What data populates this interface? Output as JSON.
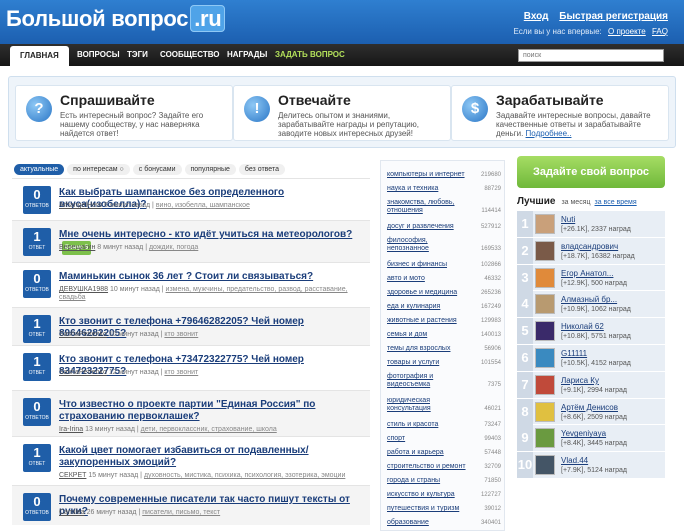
{
  "header": {
    "logo_text": "Большой вопрос",
    "logo_tld": ".ru",
    "login": "Вход",
    "register": "Быстрая регистрация",
    "first_time_text": "Если вы у нас впервые:",
    "about_link": "О проекте",
    "faq_link": "FAQ"
  },
  "nav": {
    "items": [
      "ГЛАВНАЯ",
      "ВОПРОСЫ",
      "ТЭГИ",
      "СООБЩЕСТВО",
      "НАГРАДЫ",
      "ЗАДАТЬ ВОПРОС"
    ],
    "search_placeholder": "поиск"
  },
  "promo": [
    {
      "icon": "question-icon",
      "glyph": "?",
      "title": "Спрашивайте",
      "text": "Есть интересный вопрос? Задайте его нашему сообществу, у нас наверняка найдется ответ!",
      "link": ""
    },
    {
      "icon": "exclamation-icon",
      "glyph": "!",
      "title": "Отвечайте",
      "text": "Делитесь опытом и знаниями, зарабатывайте награды и репутацию, заводите новых интересных друзей!",
      "link": ""
    },
    {
      "icon": "dollar-icon",
      "glyph": "$",
      "title": "Зарабатывайте",
      "text": "Задавайте интересные вопросы, давайте качественные ответы и зарабатывайте деньги.",
      "link": "Подробнее.."
    }
  ],
  "filter_tabs": [
    "актуальные",
    "по интересам ○",
    "с бонусами",
    "популярные",
    "без ответа"
  ],
  "questions": [
    {
      "count": "0",
      "count_label": "ОТВЕТОВ",
      "title": "Как выбрать шампанское без определенного вкуса(изобелла)?",
      "bonus": "",
      "user": "ArhangelHero",
      "time": "6 минут назад",
      "tags": "вино, изобелла, шампанское"
    },
    {
      "count": "1",
      "count_label": "ОТВЕТ",
      "title": "Мне очень интересно - кто идёт учиться на метеорологов?",
      "bonus": "Бонус 5",
      "user": "Верещагин",
      "time": "8 минут назад",
      "tags": "дождик, погода"
    },
    {
      "count": "0",
      "count_label": "ОТВЕТОВ",
      "title": "Маминькин сынок 36 лет ? Стоит ли связываться?",
      "bonus": "",
      "user": "ДЕВУШКА1988",
      "time": "10 минут назад",
      "tags": "измена, мужчины, предательство, развод, расставание, свадьба"
    },
    {
      "count": "1",
      "count_label": "ОТВЕТ",
      "title": "Кто звонит с телефона +79646282205? Чей номер 89646282205?",
      "bonus": "",
      "user": "SashaPetrenko",
      "time": "10 минут назад",
      "tags": "кто звонит"
    },
    {
      "count": "1",
      "count_label": "ОТВЕТ",
      "title": "Кто звонит с телефона +73472322775? Чей номер 83472322775?",
      "bonus": "",
      "user": "SashaPetrenko",
      "time": "12 минут назад",
      "tags": "кто звонит"
    },
    {
      "count": "0",
      "count_label": "ОТВЕТОВ",
      "title": "Что известно о проекте партии \"Единая Россия\" по страхованию первоклашек?",
      "bonus": "",
      "user": "Ira-Irina",
      "time": "13 минут назад",
      "tags": "дети, первоклассник, страхование, школа"
    },
    {
      "count": "1",
      "count_label": "ОТВЕТ",
      "title": "Какой цвет помогает избавиться от подавленных/закупоренных эмоций?",
      "bonus": "",
      "user": "СЕКРЕТ",
      "time": "15 минут назад",
      "tags": "духовность, мистика, психика, психология, эзотерика, эмоции"
    },
    {
      "count": "0",
      "count_label": "ОТВЕТОВ",
      "title": "Почему современные писатели так часто пишут тексты от руки?",
      "bonus": "",
      "user": "Camileа",
      "time": "26 минут назад",
      "tags": "писатели, письмо, текст"
    }
  ],
  "categories": [
    {
      "name": "компьютеры и интернет",
      "count": "219680"
    },
    {
      "name": "наука и техника",
      "count": "88729"
    },
    {
      "name": "знакомства, любовь, отношения",
      "count": "114414"
    },
    {
      "name": "досуг и развлечения",
      "count": "527912"
    },
    {
      "name": "философия, непознанное",
      "count": "169533"
    },
    {
      "name": "бизнес и финансы",
      "count": "102866"
    },
    {
      "name": "авто и мото",
      "count": "46332"
    },
    {
      "name": "здоровье и медицина",
      "count": "265236"
    },
    {
      "name": "еда и кулинария",
      "count": "167249"
    },
    {
      "name": "животные и растения",
      "count": "129983"
    },
    {
      "name": "семья и дом",
      "count": "140013"
    },
    {
      "name": "темы для взрослых",
      "count": "56906"
    },
    {
      "name": "товары и услуги",
      "count": "101554"
    },
    {
      "name": "фотография и видеосъемка",
      "count": "7375"
    },
    {
      "name": "юридическая консультация",
      "count": "46021"
    },
    {
      "name": "стиль и красота",
      "count": "73247"
    },
    {
      "name": "спорт",
      "count": "99403"
    },
    {
      "name": "работа и карьера",
      "count": "57448"
    },
    {
      "name": "строительство и ремонт",
      "count": "32709"
    },
    {
      "name": "города и страны",
      "count": "71850"
    },
    {
      "name": "искусство и культура",
      "count": "122727"
    },
    {
      "name": "путешествия и туризм",
      "count": "39012"
    },
    {
      "name": "образование",
      "count": "340401"
    }
  ],
  "sidebar": {
    "ask_button": "Задайте свой вопрос",
    "best_title": "Лучшие",
    "period_month": "за месяц",
    "period_all": "за все время",
    "leaders": [
      {
        "rank": "1",
        "name": "Nuti",
        "stats": "[+26.1K], 2337 наград",
        "avatar": "#c9a07a"
      },
      {
        "rank": "2",
        "name": "владсандрович",
        "stats": "[+18.7K], 16382 наград",
        "avatar": "#7a5a48"
      },
      {
        "rank": "3",
        "name": "Егор Анатол...",
        "stats": "[+12.9K], 500 наград",
        "avatar": "#e08a3a"
      },
      {
        "rank": "4",
        "name": "Алмазный бр...",
        "stats": "[+10.9K], 1062 наград",
        "avatar": "#b89a70"
      },
      {
        "rank": "5",
        "name": "Николай 62",
        "stats": "[+10.8K], 5751 наград",
        "avatar": "#3a2a6a"
      },
      {
        "rank": "6",
        "name": "G11111",
        "stats": "[+10.5K], 4152 наград",
        "avatar": "#3a8ac0"
      },
      {
        "rank": "7",
        "name": "Лариса Ку",
        "stats": "[+9.1K], 2994 наград",
        "avatar": "#c04a3a"
      },
      {
        "rank": "8",
        "name": "Артём Денисов",
        "stats": "[+8.6K], 2509 наград",
        "avatar": "#e0c040"
      },
      {
        "rank": "9",
        "name": "Yevgeniyaya",
        "stats": "[+8.4K], 3445 наград",
        "avatar": "#6a9a40"
      },
      {
        "rank": "10",
        "name": "Vlad.44",
        "stats": "[+7.9K], 5124 наград",
        "avatar": "#445566"
      }
    ]
  }
}
